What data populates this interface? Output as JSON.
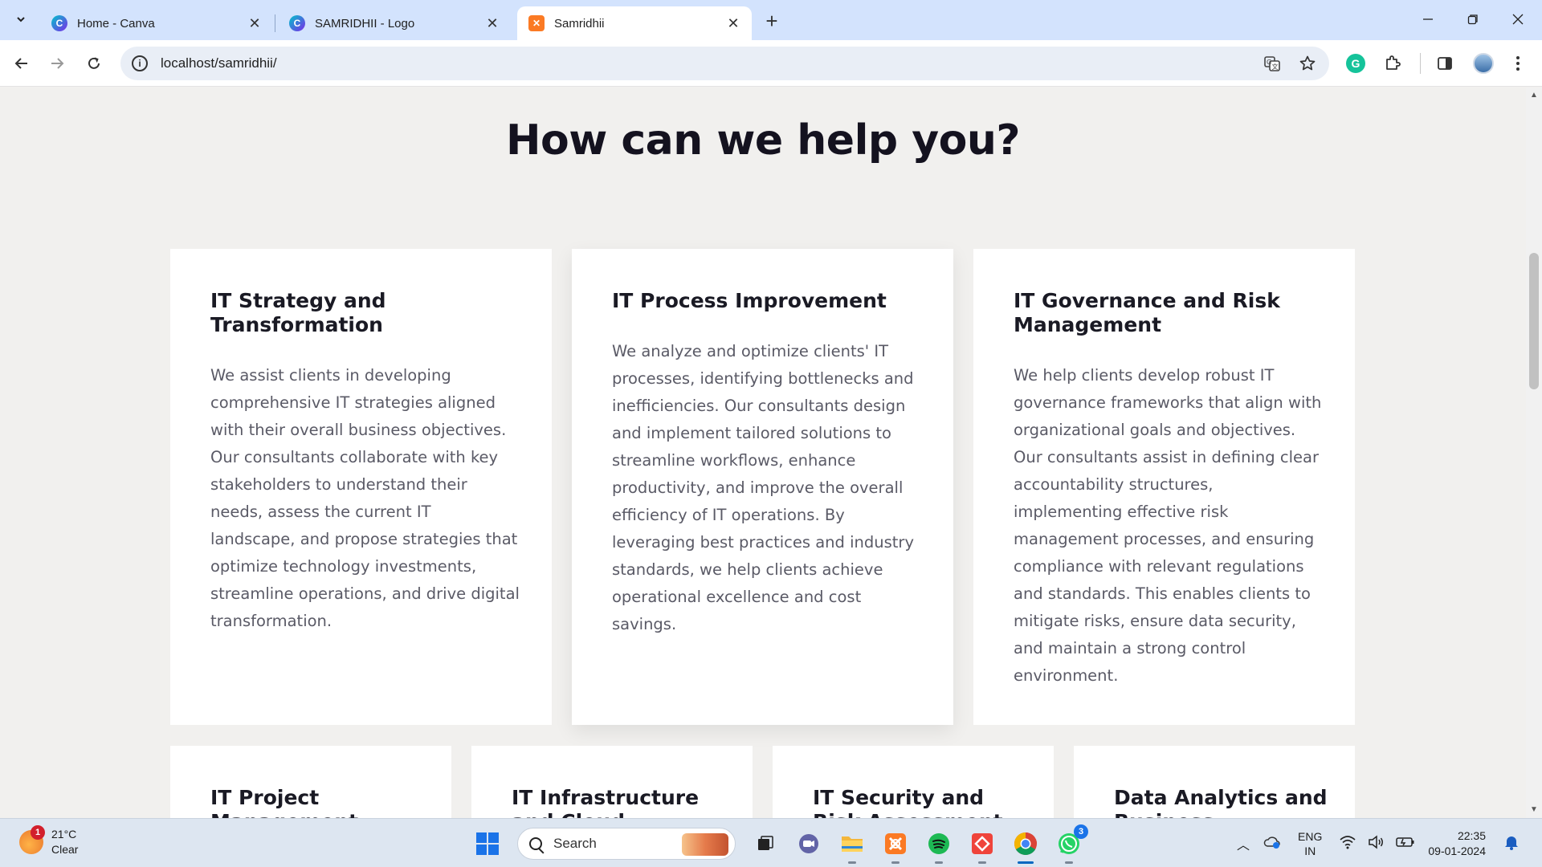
{
  "browser": {
    "tabs": [
      {
        "title": "Home - Canva",
        "favicon": "canva-icon",
        "active": false
      },
      {
        "title": "SAMRIDHII - Logo",
        "favicon": "canva-icon",
        "active": false
      },
      {
        "title": "Samridhii",
        "favicon": "xampp-icon",
        "active": true
      }
    ],
    "address": "localhost/samridhii/"
  },
  "page": {
    "heading": "How can we help you?",
    "services": [
      {
        "title": "IT Strategy and Transformation",
        "description": "We assist clients in developing comprehensive IT strategies aligned with their overall business objectives. Our consultants collaborate with key stakeholders to understand their needs, assess the current IT landscape, and propose strategies that optimize technology investments, streamline operations, and drive digital transformation."
      },
      {
        "title": "IT Process Improvement",
        "description": "We analyze and optimize clients' IT processes, identifying bottlenecks and inefficiencies. Our consultants design and implement tailored solutions to streamline workflows, enhance productivity, and improve the overall efficiency of IT operations. By leveraging best practices and industry standards, we help clients achieve operational excellence and cost savings."
      },
      {
        "title": "IT Governance and Risk Management",
        "description": "We help clients develop robust IT governance frameworks that align with organizational goals and objectives. Our consultants assist in defining clear accountability structures, implementing effective risk management processes, and ensuring compliance with relevant regulations and standards. This enables clients to mitigate risks, ensure data security, and maintain a strong control environment."
      },
      {
        "title": "IT Project Management"
      },
      {
        "title": "IT Infrastructure and Cloud Solutions"
      },
      {
        "title": "IT Security and Risk Assessment"
      },
      {
        "title": "Data Analytics and Business"
      }
    ]
  },
  "taskbar": {
    "weather": {
      "temp": "21°C",
      "condition": "Clear",
      "badge": "1"
    },
    "search_placeholder": "Search",
    "whatsapp_badge": "3",
    "language": {
      "line1": "ENG",
      "line2": "IN"
    },
    "clock": {
      "time": "22:35",
      "date": "09-01-2024"
    }
  }
}
